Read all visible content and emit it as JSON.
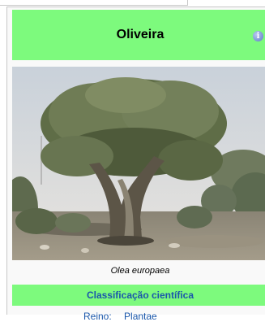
{
  "infobox": {
    "title": "Oliveira",
    "info_icon": "info-icon",
    "caption": "Olea europaea",
    "classification_title": "Classificação científica",
    "rows": [
      {
        "label": "Reino:",
        "value": "Plantae"
      }
    ]
  },
  "colors": {
    "header_bg": "#7dfa7d",
    "link": "#1a57ab",
    "background": "#f9f9f9"
  }
}
